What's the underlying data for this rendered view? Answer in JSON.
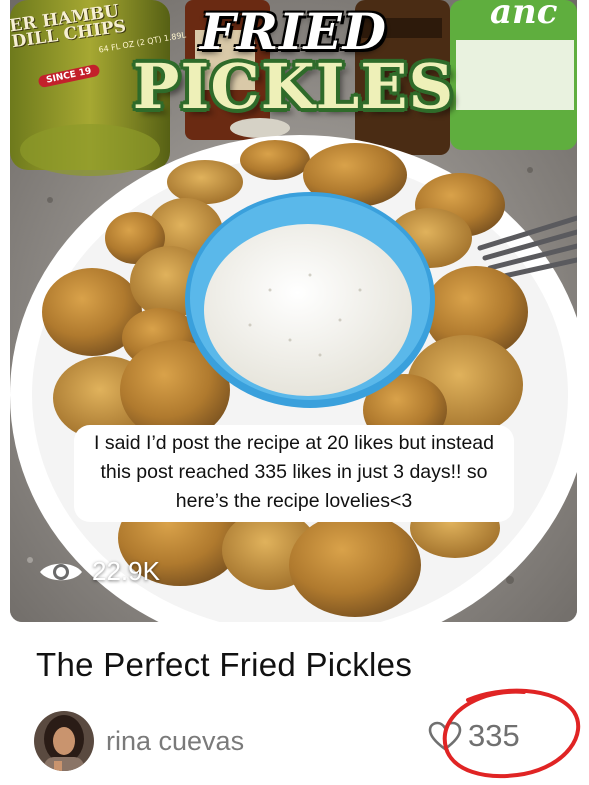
{
  "hero": {
    "title_line1": "FRIED",
    "title_line2": "PICKLES",
    "jar_label": "ER HAMBU\nDILL CHIPS",
    "jar_size": "64 FL OZ (2 QT) 1.89L",
    "jar_since": "SINCE 19",
    "bottle_label": "anc",
    "caption": "I said I’d post the recipe at 20 likes but instead this post reached 335 likes in just 3 days!! so here’s the recipe lovelies<3",
    "views": "22.9K",
    "views_icon": "eye-icon"
  },
  "post": {
    "title": "The Perfect Fried Pickles",
    "author": "rina cuevas",
    "likes": "335",
    "likes_icon": "heart-outline-icon"
  },
  "colors": {
    "highlight_circle": "#e02424",
    "title_green": "#2f6b2a",
    "dip_bowl": "#4fb3e8"
  }
}
